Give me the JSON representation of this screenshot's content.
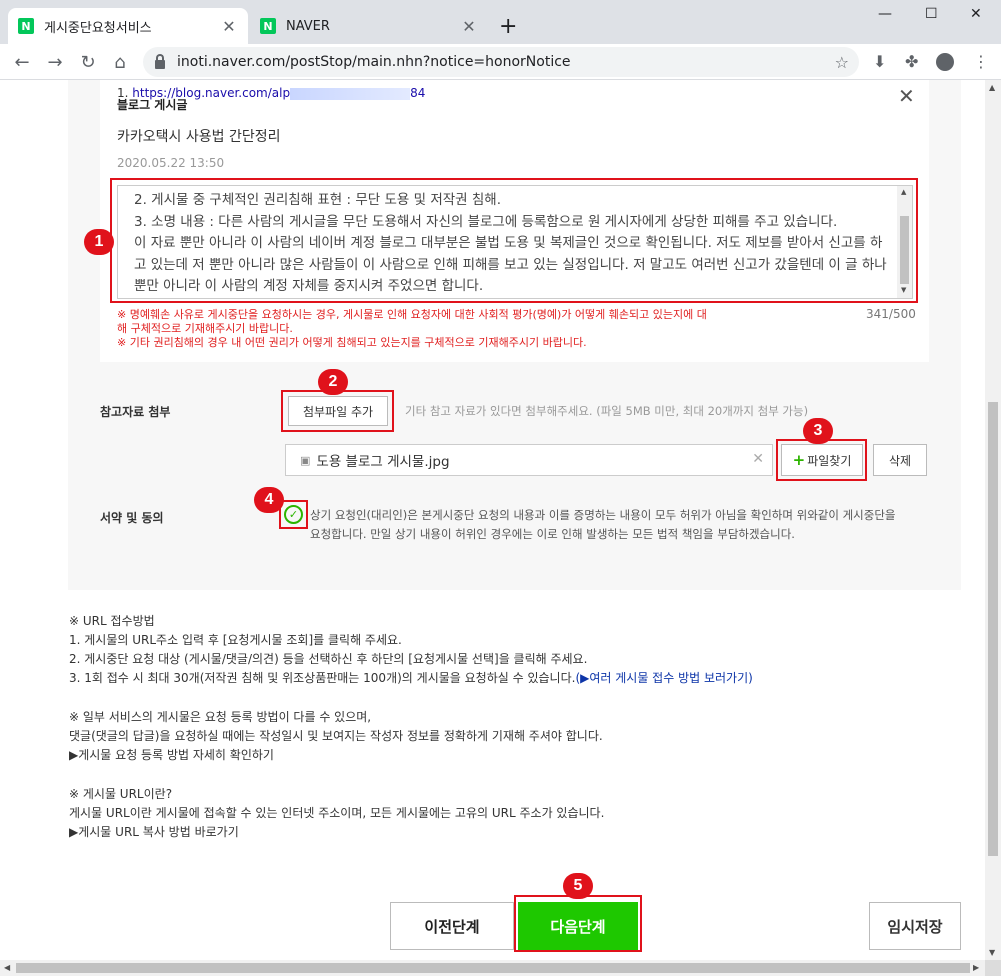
{
  "browser": {
    "tabs": [
      {
        "title": "게시중단요청서비스",
        "favicon": "N"
      },
      {
        "title": "NAVER",
        "favicon": "N"
      }
    ],
    "address": "inoti.naver.com/postStop/main.nhn?notice=honorNotice"
  },
  "post": {
    "url_prefix": "1.",
    "url_start": "https://blog.naver.com/alp",
    "url_end": "84",
    "type": "블로그 게시글",
    "title": "카카오택시 사용법 간단정리",
    "date": "2020.05.22 13:50",
    "details": "2. 게시물 중 구체적인 권리침해 표현 : 무단 도용 및 저작권 침해.\n3. 소명 내용 : 다른 사람의 게시글을 무단 도용해서 자신의 블로그에 등록함으로 원 게시자에게 상당한 피해를 주고 있습니다.\n이 자료 뿐만 아니라 이 사람의 네이버 계정 블로그 대부분은 불법 도용 및 복제글인 것으로 확인됩니다. 저도 제보를 받아서 신고를 하고 있는데 저 뿐만 아니라 많은 사람들이 이 사람으로 인해 피해를 보고 있는 실정입니다. 저 말고도 여러번 신고가 갔을텐데 이 글 하나 뿐만 아니라 이 사람의 계정 자체를 중지시켜 주었으면 합니다.",
    "notice1": "※ 명예훼손 사유로 게시중단을 요청하시는 경우, 게시물로 인해 요청자에 대한 사회적 평가(명예)가 어떻게 훼손되고 있는지에 대",
    "notice1b": "해 구체적으로 기재해주시기 바랍니다.",
    "notice2": "※ 기타 권리침해의 경우 내 어떤 권리가 어떻게 침해되고 있는지를 구체적으로 기재해주시기 바랍니다.",
    "counter": "341/500"
  },
  "attach": {
    "label": "참고자료 첨부",
    "add_button": "첨부파일 추가",
    "hint": "기타 참고 자료가 있다면 첨부해주세요. (파일 5MB 미만, 최대 20개까지 첨부 가능)",
    "file_name": "도용 블로그 게시물.jpg",
    "find_button": "파일찾기",
    "delete_button": "삭제"
  },
  "agree": {
    "label": "서약 및 동의",
    "text": "상기 요청인(대리인)은 본게시중단 요청의 내용과 이를 증명하는 내용이 모두 허위가 아님을 확인하며 위와같이 게시중단을 요청합니다. 만일 상기 내용이 허위인 경우에는 이로 인해 발생하는 모든 법적 책임을 부담하겠습니다."
  },
  "guide": {
    "url_title": "※ URL 접수방법",
    "url_1": "1. 게시물의 URL주소 입력 후 [요청게시물 조회]를 클릭해 주세요.",
    "url_2": "2. 게시중단 요청 대상 (게시물/댓글/의견) 등을 선택하신 후 하단의 [요청게시물 선택]을 클릭해 주세요.",
    "url_3": "3. 1회 접수 시 최대 30개(저작권 침해 및 위조상품판매는 100개)의 게시물을 요청하실 수 있습니다.",
    "url_3_link": "(▶여러 게시물 접수 방법 보러가기)",
    "svc_title": "※ 일부 서비스의 게시물은 요청 등록 방법이 다를 수 있으며,",
    "svc_1": "댓글(댓글의 답글)을 요청하실 때에는 작성일시 및 보여지는 작성자 정보를 정확하게 기재해 주셔야 합니다.",
    "svc_link": "▶게시물 요청 등록 방법 자세히 확인하기",
    "what_title": "※ 게시물 URL이란?",
    "what_1": "게시물 URL이란 게시물에 접속할 수 있는 인터넷 주소이며, 모든 게시물에는 고유의 URL 주소가 있습니다.",
    "what_link": "▶게시물 URL 복사 방법 바로가기"
  },
  "buttons": {
    "prev": "이전단계",
    "next": "다음단계",
    "save": "임시저장"
  },
  "annotations": [
    "1",
    "2",
    "3",
    "4",
    "5"
  ]
}
